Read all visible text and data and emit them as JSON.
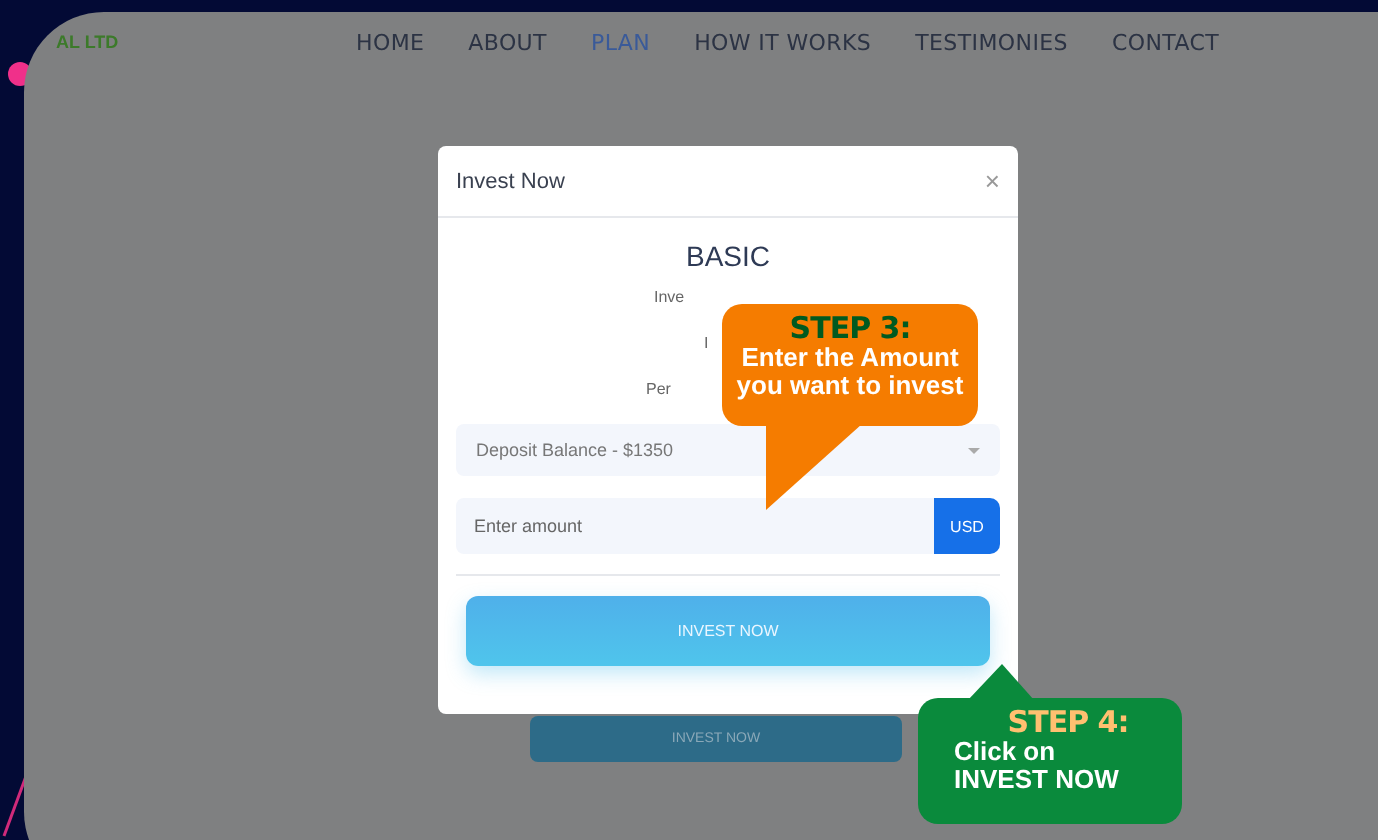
{
  "logo": {
    "text": "AL LTD"
  },
  "nav": [
    {
      "label": "HOME",
      "selected": false
    },
    {
      "label": "ABOUT",
      "selected": false
    },
    {
      "label": "PLAN",
      "selected": true
    },
    {
      "label": "HOW IT WORKS",
      "selected": false
    },
    {
      "label": "TESTIMONIES",
      "selected": false
    },
    {
      "label": "CONTACT",
      "selected": false
    }
  ],
  "background_button": "INVEST NOW",
  "modal": {
    "title": "Invest Now",
    "close": "×",
    "plan": "BASIC",
    "details": [
      "Inve",
      "I",
      "Per"
    ],
    "select": {
      "value": "Deposit Balance - $1350"
    },
    "amount": {
      "placeholder": "Enter amount",
      "currency": "USD"
    },
    "submit": "INVEST NOW"
  },
  "callouts": [
    {
      "kind": "step3",
      "step": "STEP 3:",
      "lines": [
        "Enter the Amount",
        "you want to invest"
      ]
    },
    {
      "kind": "step4",
      "step": "STEP 4:",
      "lines": [
        "Click on",
        "INVEST NOW"
      ]
    }
  ]
}
